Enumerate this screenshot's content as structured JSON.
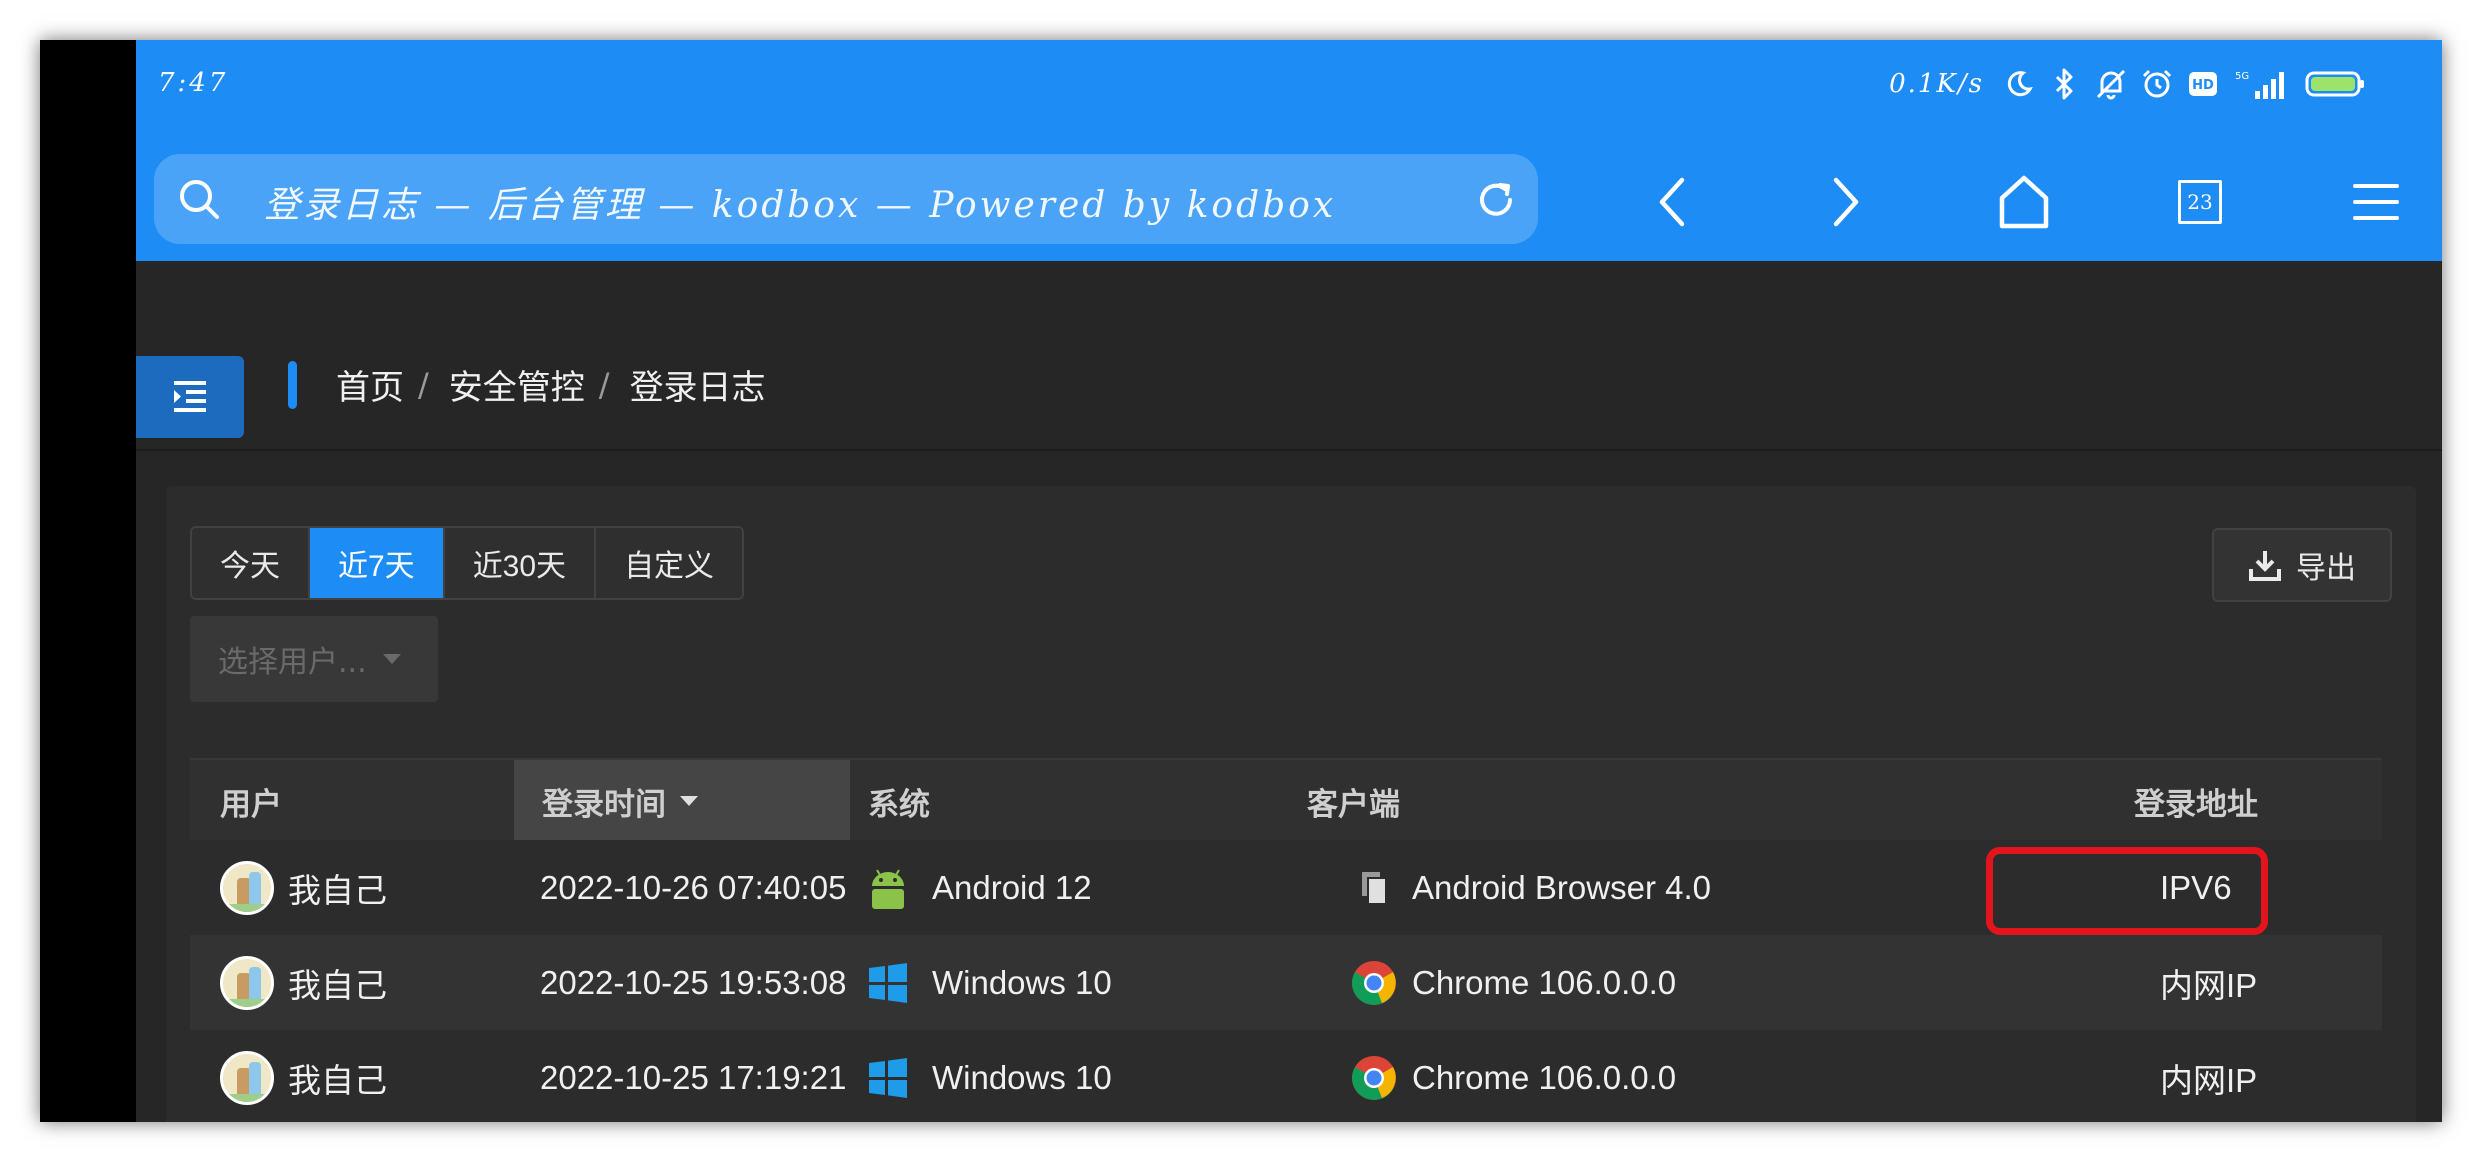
{
  "status": {
    "time": "7:47",
    "speed": "0.1K/s",
    "network": "5G"
  },
  "browser": {
    "url_text": "登录日志 — 后台管理 — kodbox — Powered by kodbox",
    "tab_count": "23"
  },
  "breadcrumb": {
    "items": [
      "首页",
      "安全管控",
      "登录日志"
    ],
    "separator": "/"
  },
  "filters": {
    "ranges": [
      "今天",
      "近7天",
      "近30天",
      "自定义"
    ],
    "active_range": "近7天",
    "user_placeholder": "选择用户..."
  },
  "export_label": "导出",
  "table": {
    "columns": [
      "用户",
      "登录时间",
      "系统",
      "客户端",
      "登录地址"
    ],
    "sorted_column": "登录时间",
    "rows": [
      {
        "user": "我自己",
        "time": "2022-10-26 07:40:05",
        "os": "Android 12",
        "os_icon": "android-icon",
        "client": "Android Browser 4.0",
        "client_icon": "browser-icon",
        "address": "IPV6"
      },
      {
        "user": "我自己",
        "time": "2022-10-25 19:53:08",
        "os": "Windows 10",
        "os_icon": "windows-icon",
        "client": "Chrome 106.0.0.0",
        "client_icon": "chrome-icon",
        "address": "内网IP"
      },
      {
        "user": "我自己",
        "time": "2022-10-25 17:19:21",
        "os": "Windows 10",
        "os_icon": "windows-icon",
        "client": "Chrome 106.0.0.0",
        "client_icon": "chrome-icon",
        "address": "内网IP"
      }
    ]
  },
  "colors": {
    "accent": "#1e8cf5",
    "highlight": "#e3141b",
    "android": "#8bc34a",
    "windows": "#1e9be9"
  }
}
